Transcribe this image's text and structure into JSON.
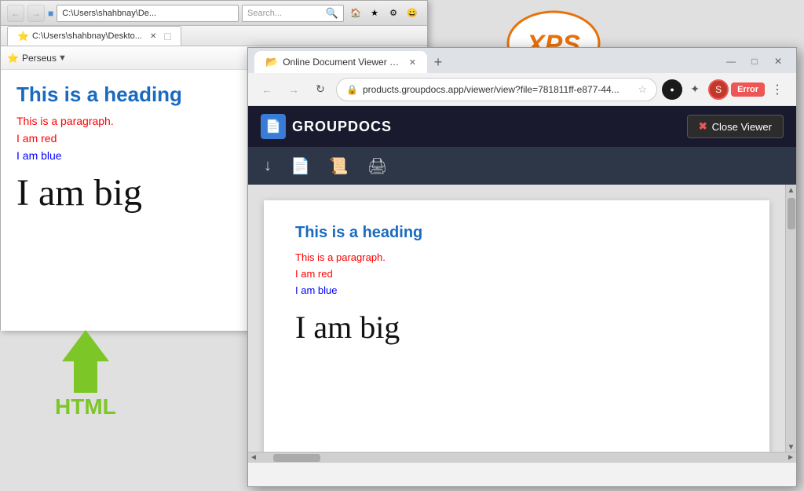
{
  "bg_window": {
    "address": "C:\\Users\\shahbnay\\De...",
    "search_placeholder": "Search...",
    "tab_label": "C:\\Users\\shahbnay\\Deskto...",
    "toolbar_label": "Perseus",
    "heading": "This is a heading",
    "paragraph": "This is a paragraph.",
    "red_text": "I am red",
    "blue_text": "I am blue",
    "big_text": "I am big"
  },
  "arrow_label": "HTML",
  "xps_label": "XPS",
  "chrome_window": {
    "tab_label": "Online Document Viewer | Free O",
    "address": "products.groupdocs.app/viewer/view?file=781811ff-e877-44...",
    "new_tab_symbol": "+",
    "nav_back": "←",
    "nav_forward": "→",
    "nav_refresh": "↻",
    "error_label": "Error",
    "groupdocs_logo": "GROUPDOCS",
    "close_viewer_label": "Close Viewer",
    "doc": {
      "heading": "This is a heading",
      "paragraph": "This is a paragraph.",
      "red_text": "I am red",
      "blue_text": "I am blue",
      "big_text": "I am big"
    },
    "window_controls": {
      "minimize": "—",
      "maximize": "□",
      "close": "✕"
    }
  }
}
